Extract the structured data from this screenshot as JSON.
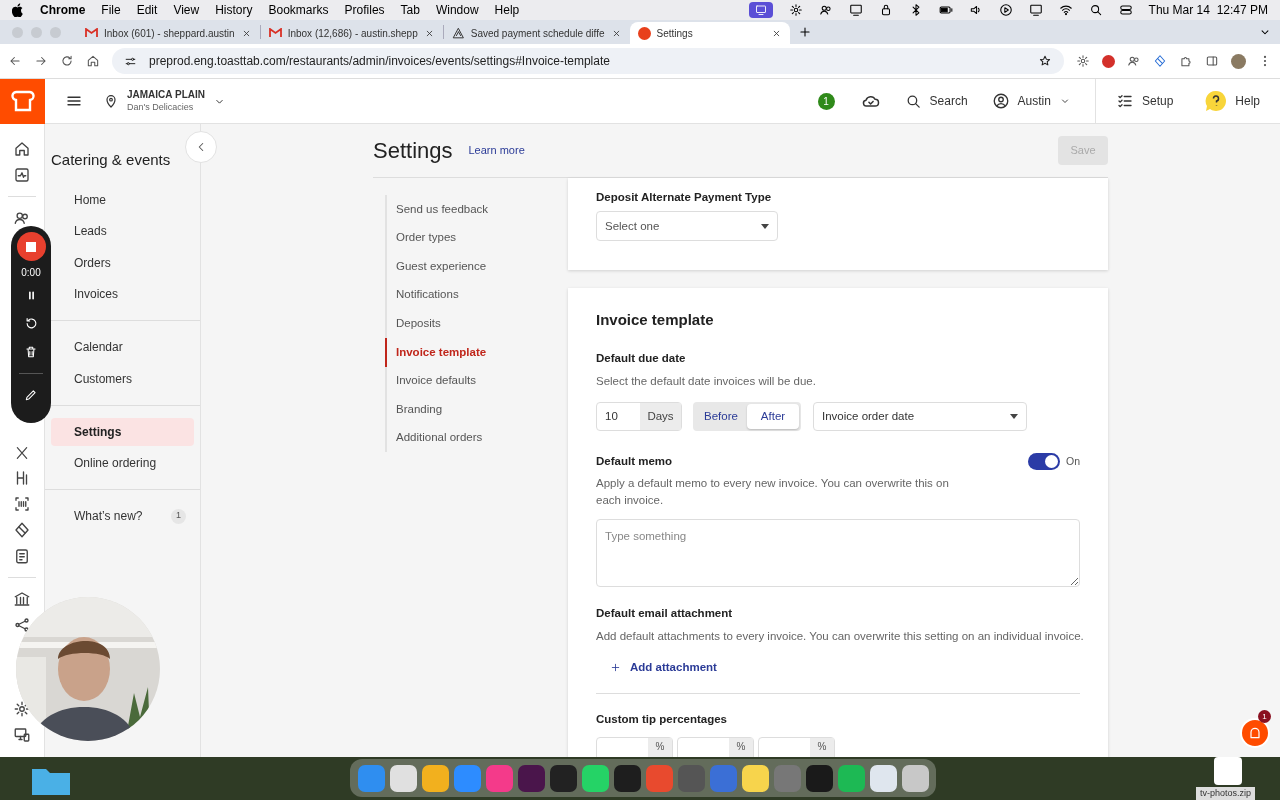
{
  "menubar": {
    "app": "Chrome",
    "menus": [
      "File",
      "Edit",
      "View",
      "History",
      "Bookmarks",
      "Profiles",
      "Tab",
      "Window",
      "Help"
    ],
    "clock": "Thu Mar 14  12:47 PM"
  },
  "tabs": [
    {
      "title": "Inbox (601) - sheppard.austin",
      "kind": "mail",
      "selected": false
    },
    {
      "title": "Inbox (12,686) - austin.shepp",
      "kind": "mail",
      "selected": false
    },
    {
      "title": "Saved payment schedule diffe",
      "kind": "doc",
      "selected": false
    },
    {
      "title": "Settings",
      "kind": "app",
      "selected": true
    }
  ],
  "address": "preprod.eng.toasttab.com/restaurants/admin/invoices/events/settings#Invoice-template",
  "header": {
    "location": "JAMAICA PLAIN",
    "restaurant": "Dan's Delicacies",
    "notifications": "1",
    "search": "Search",
    "user": "Austin",
    "setup": "Setup",
    "help": "Help"
  },
  "recorder": {
    "time": "0:00"
  },
  "sidebar": {
    "title": "Catering & events",
    "groups": [
      [
        {
          "label": "Home",
          "selected": false
        },
        {
          "label": "Leads",
          "selected": false
        },
        {
          "label": "Orders",
          "selected": false
        },
        {
          "label": "Invoices",
          "selected": false
        }
      ],
      [
        {
          "label": "Calendar",
          "selected": false
        },
        {
          "label": "Customers",
          "selected": false
        }
      ],
      [
        {
          "label": "Settings",
          "selected": true
        },
        {
          "label": "Online ordering",
          "selected": false
        }
      ],
      [
        {
          "label": "What’s new?",
          "selected": false,
          "badge": "1"
        }
      ]
    ]
  },
  "page": {
    "title": "Settings",
    "learn_more": "Learn more",
    "save": {
      "label": "Save",
      "disabled": true
    }
  },
  "section_nav": [
    {
      "label": "Send us feedback",
      "selected": false
    },
    {
      "label": "Order types",
      "selected": false
    },
    {
      "label": "Guest experience",
      "selected": false
    },
    {
      "label": "Notifications",
      "selected": false
    },
    {
      "label": "Deposits",
      "selected": false
    },
    {
      "label": "Invoice template",
      "selected": true
    },
    {
      "label": "Invoice defaults",
      "selected": false
    },
    {
      "label": "Branding",
      "selected": false
    },
    {
      "label": "Additional orders",
      "selected": false
    }
  ],
  "deposit": {
    "label": "Deposit Alternate Payment Type",
    "placeholder": "Select one"
  },
  "invoice_template": {
    "title": "Invoice template",
    "due_date": {
      "label": "Default due date",
      "description": "Select the default date invoices will be due.",
      "days": "10",
      "unit": "Days",
      "options": [
        {
          "label": "Before",
          "selected": false
        },
        {
          "label": "After",
          "selected": true
        }
      ],
      "anchor": "Invoice order date"
    },
    "memo": {
      "label": "Default memo",
      "on": true,
      "state_label": "On",
      "description": "Apply a default memo to every new invoice. You can overwrite this on each invoice.",
      "placeholder": "Type something"
    },
    "attachment": {
      "label": "Default email attachment",
      "description": "Add default attachments to every invoice. You can overwrite this setting on an individual invoice.",
      "action": "Add attachment"
    },
    "tips": {
      "label": "Custom tip percentages",
      "suffixes": [
        "%",
        "%",
        "%"
      ]
    }
  },
  "chat_badge": "1",
  "desktop_file": "tv-photos.zip"
}
